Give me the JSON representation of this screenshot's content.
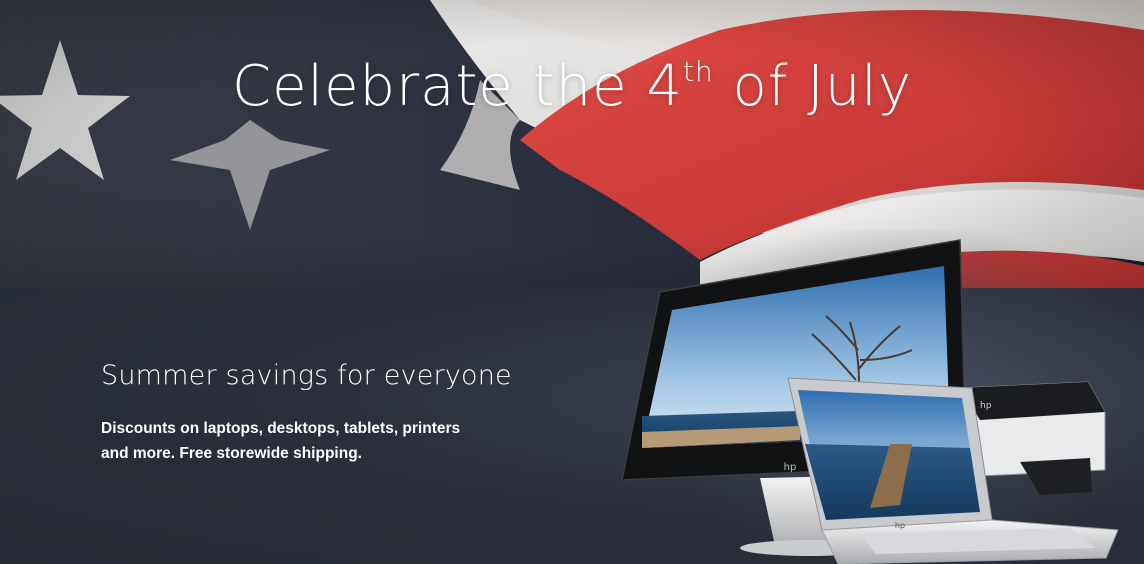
{
  "hero": {
    "title_main": "Celebrate the 4",
    "title_sup": "th",
    "title_end": " of July"
  },
  "promo": {
    "heading": "Summer savings for everyone",
    "body": "Discounts on laptops, desktops, tablets, printers and more. Free storewide shipping."
  },
  "colors": {
    "promo_bg": "#2a2f3b",
    "flag_red": "#d9433f",
    "flag_navy": "#2b3042",
    "flag_white": "#e8e6e4"
  },
  "images": {
    "hero_background": "american-flag-image",
    "product_image": "hp-devices-image"
  }
}
